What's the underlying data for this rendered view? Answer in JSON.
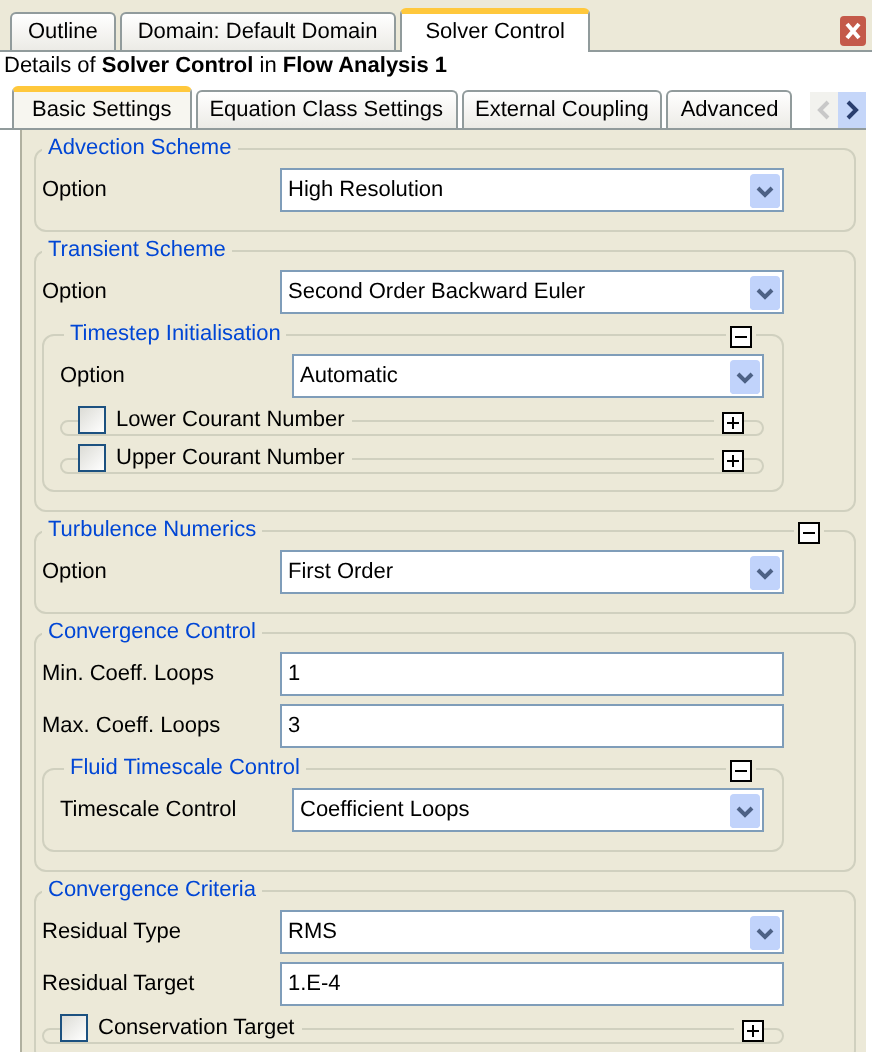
{
  "outer_tabs": [
    {
      "label": "Outline",
      "selected": false
    },
    {
      "label": "Domain: Default Domain",
      "selected": false
    },
    {
      "label": "Solver Control",
      "selected": true
    }
  ],
  "details": "Details of **Solver Control** in **Flow Analysis 1**",
  "inner_tabs": [
    {
      "label": "Basic Settings",
      "selected": true
    },
    {
      "label": "Equation Class Settings",
      "selected": false
    },
    {
      "label": "External Coupling",
      "selected": false
    },
    {
      "label": "Advanced",
      "selected": false
    }
  ],
  "groups": [
    {
      "title": "Advection Scheme",
      "kind": "plain",
      "items": [
        {
          "kind": "dropdown",
          "label": "Option",
          "value": "High Resolution"
        }
      ]
    },
    {
      "title": "Transient Scheme",
      "kind": "plain",
      "items": [
        {
          "kind": "dropdown",
          "label": "Option",
          "value": "Second Order Backward Euler"
        },
        {
          "kind": "subgroup",
          "title": "Timestep Initialisation",
          "expanded": true,
          "items": [
            {
              "kind": "dropdown",
              "label": "Option",
              "value": "Automatic"
            },
            {
              "kind": "option_section",
              "label": "Lower Courant Number",
              "checked": false,
              "expanded": false
            },
            {
              "kind": "option_section",
              "label": "Upper Courant Number",
              "checked": false,
              "expanded": false
            }
          ]
        }
      ]
    },
    {
      "title": "Turbulence Numerics",
      "kind": "collapsible",
      "expanded": true,
      "items": [
        {
          "kind": "dropdown",
          "label": "Option",
          "value": "First Order"
        }
      ]
    },
    {
      "title": "Convergence Control",
      "kind": "plain",
      "items": [
        {
          "kind": "field",
          "label": "Min. Coeff. Loops",
          "value": "1"
        },
        {
          "kind": "field",
          "label": "Max. Coeff. Loops",
          "value": "3"
        },
        {
          "kind": "subgroup",
          "title": "Fluid Timescale Control",
          "expanded": true,
          "items": [
            {
              "kind": "dropdown",
              "label": "Timescale Control",
              "value": "Coefficient Loops"
            }
          ]
        }
      ]
    },
    {
      "title": "Convergence Criteria",
      "kind": "plain",
      "items": [
        {
          "kind": "dropdown",
          "label": "Residual Type",
          "value": "RMS"
        },
        {
          "kind": "field",
          "label": "Residual Target",
          "value": "1.E-4"
        },
        {
          "kind": "option_section",
          "label": "Conservation Target",
          "checked": false,
          "expanded": false
        }
      ]
    }
  ]
}
